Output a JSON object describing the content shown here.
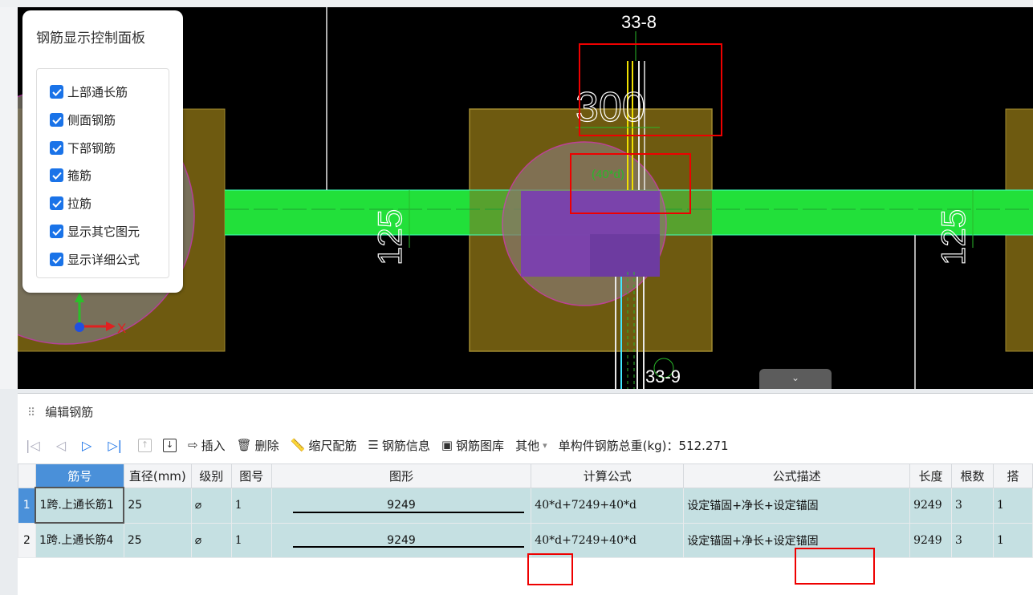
{
  "canvas": {
    "labels": {
      "top_axis": "33-8",
      "bottom_axis": "33-9",
      "dim_300": "300",
      "dim_125_left": "125",
      "dim_125_right": "125",
      "anchor_label": "(40*d)",
      "axis_x": "X"
    }
  },
  "panel": {
    "title": "钢筋显示控制面板",
    "items": [
      {
        "label": "上部通长筋",
        "checked": true
      },
      {
        "label": "侧面钢筋",
        "checked": true
      },
      {
        "label": "下部钢筋",
        "checked": true
      },
      {
        "label": "箍筋",
        "checked": true
      },
      {
        "label": "拉筋",
        "checked": true
      },
      {
        "label": "显示其它图元",
        "checked": true
      },
      {
        "label": "显示详细公式",
        "checked": true
      }
    ]
  },
  "editor": {
    "title": "编辑钢筋",
    "toolbar": {
      "insert": "插入",
      "delete": "删除",
      "scale": "缩尺配筋",
      "info": "钢筋信息",
      "library": "钢筋图库",
      "other": "其他",
      "total_weight": "单构件钢筋总重(kg)：512.271"
    },
    "columns": [
      "筋号",
      "直径(mm)",
      "级别",
      "图号",
      "图形",
      "计算公式",
      "公式描述",
      "长度",
      "根数",
      "搭"
    ],
    "rows": [
      {
        "num": "1",
        "name": "1跨.上通长筋1",
        "diameter": "25",
        "grade": "⌀",
        "figure_no": "1",
        "shape_value": "9249",
        "formula": "40*d+7249+40*d",
        "description": "设定锚固+净长+设定锚固",
        "length": "9249",
        "count": "3",
        "lap": "1"
      },
      {
        "num": "2",
        "name": "1跨.上通长筋4",
        "diameter": "25",
        "grade": "⌀",
        "figure_no": "1",
        "shape_value": "9249",
        "formula": "40*d+7249+40*d",
        "description": "设定锚固+净长+设定锚固",
        "length": "9249",
        "count": "3",
        "lap": "1"
      }
    ]
  },
  "colors": {
    "beam": "#22e03a",
    "column": "#6e5a10",
    "purple": "#7a3fb0",
    "highlight": "#e00000",
    "selection": "#4a90d9"
  }
}
